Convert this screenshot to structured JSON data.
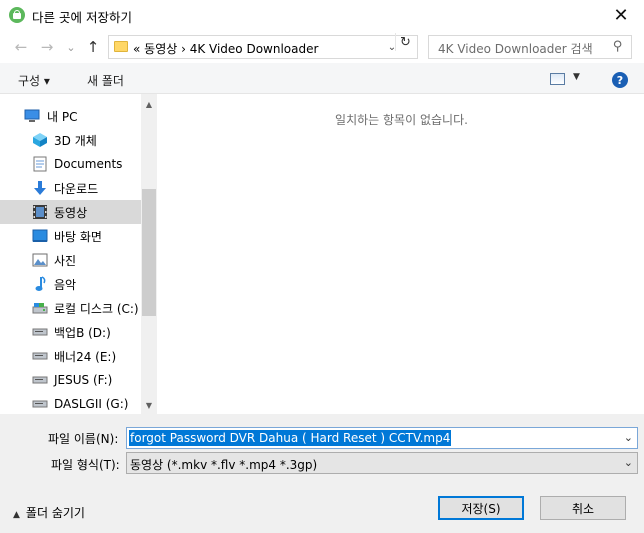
{
  "window": {
    "title": "다른 곳에 저장하기",
    "close_glyph": "✕"
  },
  "nav": {
    "back_glyph": "←",
    "forward_glyph": "→",
    "recent_glyph": "⌄",
    "up_glyph": "↑",
    "address_path": "«  동영상  ›  4K Video Downloader",
    "address_dropdown_glyph": "⌄",
    "refresh_glyph": "↻",
    "search_placeholder": "4K Video Downloader 검색",
    "search_glyph": "⚲"
  },
  "toolbar": {
    "organize_label": "구성 ▾",
    "new_folder_label": "새 폴더",
    "view_dropdown_glyph": "▼",
    "help_glyph": "?"
  },
  "sidebar": {
    "items": [
      {
        "label": "내 PC",
        "icon": "pc-icon"
      },
      {
        "label": "3D 개체",
        "icon": "3d-objects-icon"
      },
      {
        "label": "Documents",
        "icon": "documents-icon"
      },
      {
        "label": "다운로드",
        "icon": "download-icon"
      },
      {
        "label": "동영상",
        "icon": "videos-icon"
      },
      {
        "label": "바탕 화면",
        "icon": "desktop-icon"
      },
      {
        "label": "사진",
        "icon": "pictures-icon"
      },
      {
        "label": "음악",
        "icon": "music-icon"
      },
      {
        "label": "로컬 디스크 (C:)",
        "icon": "local-disk-icon"
      },
      {
        "label": "백업B (D:)",
        "icon": "drive-icon"
      },
      {
        "label": "배너24 (E:)",
        "icon": "drive-icon"
      },
      {
        "label": "JESUS (F:)",
        "icon": "drive-icon"
      },
      {
        "label": "DASLGII (G:)",
        "icon": "drive-icon"
      }
    ],
    "selected_index": 4,
    "scroll_up_glyph": "▲",
    "scroll_down_glyph": "▼"
  },
  "content": {
    "empty_message": "일치하는 항목이 없습니다."
  },
  "form": {
    "filename_label": "파일 이름(N):",
    "filename_value": "forgot Password DVR Dahua ( Hard Reset ) CCTV.mp4",
    "filetype_label": "파일 형식(T):",
    "filetype_value": "동영상 (*.mkv *.flv *.mp4 *.3gp)",
    "dropdown_glyph": "⌄"
  },
  "footer": {
    "hide_folders_label": "폴더 숨기기",
    "hide_folders_glyph": "▲",
    "save_label": "저장(S)",
    "cancel_label": "취소"
  }
}
